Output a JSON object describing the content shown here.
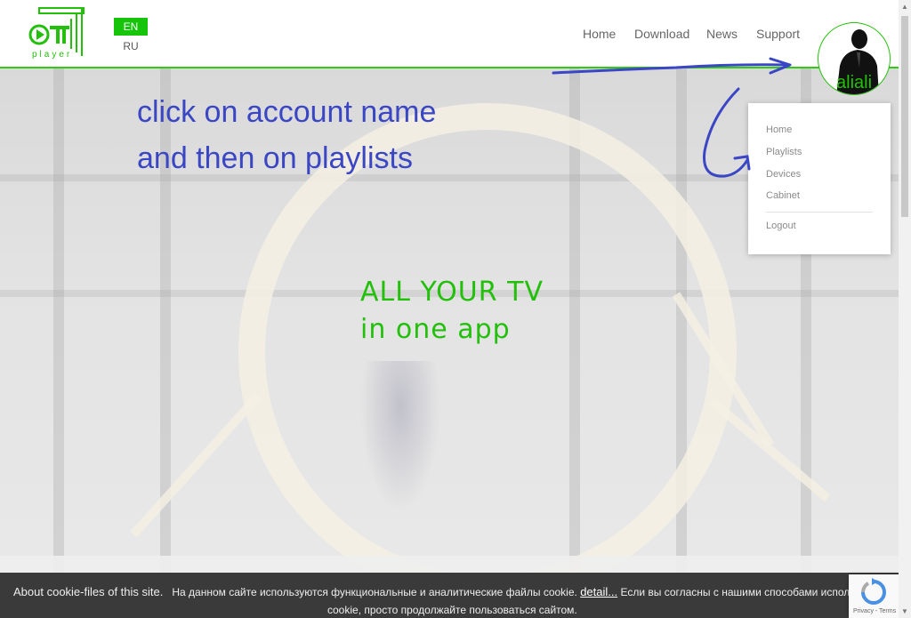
{
  "header": {
    "logo_text": "OTT player",
    "languages": {
      "active": "EN",
      "other": "RU"
    },
    "nav": [
      "Home",
      "Download",
      "News",
      "Support"
    ],
    "user": {
      "name": "aliali"
    }
  },
  "dropdown": {
    "items": [
      "Home",
      "Playlists",
      "Devices",
      "Cabinet"
    ],
    "logout": "Logout"
  },
  "annotation": {
    "line1": "click on account name",
    "line2": "and then on playlists"
  },
  "hero": {
    "line1": "ALL YOUR TV",
    "line2": "in one app"
  },
  "cookie": {
    "title": "About cookie-files of this site.",
    "text1": "На данном сайте используются функциональные и аналитические файлы cookie.",
    "link": "detail...",
    "text2": "Если вы согласны с нашими способами использования файлов",
    "text3": "cookie, просто продолжайте пользоваться сайтом."
  },
  "recaptcha": {
    "text": "Privacy - Terms"
  },
  "colors": {
    "brand_green": "#22c00a",
    "annotation_blue": "#3a46c4",
    "cookie_bg": "#3a3a3a"
  },
  "icons": [
    "ott-logo-icon",
    "play-icon",
    "user-avatar-icon",
    "recaptcha-icon",
    "annotation-arrow-icon"
  ]
}
